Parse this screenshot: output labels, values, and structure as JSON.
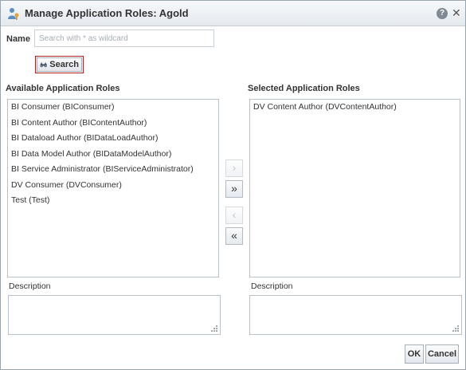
{
  "dialog": {
    "title": "Manage Application Roles: Agold",
    "help_icon": "question-mark-icon",
    "help_glyph": "?",
    "close_glyph": "✕"
  },
  "search": {
    "label": "Name",
    "placeholder": "Search with * as wildcard",
    "value": "",
    "button_label": "Search"
  },
  "available": {
    "heading": "Available Application Roles",
    "items": [
      "BI Consumer (BIConsumer)",
      "BI Content Author (BIContentAuthor)",
      "BI Dataload Author (BIDataLoadAuthor)",
      "BI Data Model Author (BIDataModelAuthor)",
      "BI Service Administrator (BIServiceAdministrator)",
      "DV Consumer (DVConsumer)",
      "Test (Test)"
    ],
    "description_label": "Description"
  },
  "selected": {
    "heading": "Selected Application Roles",
    "items": [
      "DV Content Author (DVContentAuthor)"
    ],
    "description_label": "Description"
  },
  "shuttle": {
    "move_glyph": "›",
    "move_all_glyph": "»",
    "remove_glyph": "‹",
    "remove_all_glyph": "«"
  },
  "footer": {
    "ok_label": "OK",
    "cancel_label": "Cancel"
  }
}
